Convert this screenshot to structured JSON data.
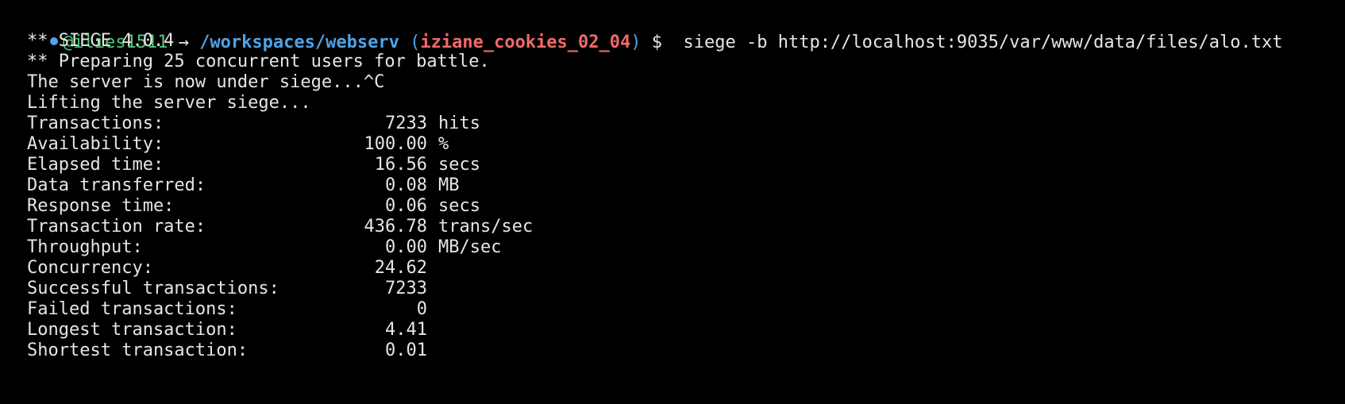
{
  "prompt": {
    "indicator_color": "#4fa3e8",
    "user": "@ilies1511",
    "arrow": "→",
    "path": "/workspaces/webserv",
    "paren_open": "(",
    "branch": "iziane_cookies_02_04",
    "paren_close": ")",
    "dollar": "$",
    "command": "siege -b http://localhost:9035/var/www/data/files/alo.txt"
  },
  "output": {
    "line1": "** SIEGE 4.0.4",
    "line2": "** Preparing 25 concurrent users for battle.",
    "line3": "The server is now under siege...^C",
    "line4": "Lifting the server siege..."
  },
  "stats": [
    {
      "label": "Transactions:",
      "value": "7233",
      "unit": "hits"
    },
    {
      "label": "Availability:",
      "value": "100.00",
      "unit": "%"
    },
    {
      "label": "Elapsed time:",
      "value": "16.56",
      "unit": "secs"
    },
    {
      "label": "Data transferred:",
      "value": "0.08",
      "unit": "MB"
    },
    {
      "label": "Response time:",
      "value": "0.06",
      "unit": "secs"
    },
    {
      "label": "Transaction rate:",
      "value": "436.78",
      "unit": "trans/sec"
    },
    {
      "label": "Throughput:",
      "value": "0.00",
      "unit": "MB/sec"
    },
    {
      "label": "Concurrency:",
      "value": "24.62",
      "unit": ""
    },
    {
      "label": "Successful transactions:",
      "value": "7233",
      "unit": ""
    },
    {
      "label": "Failed transactions:",
      "value": "0",
      "unit": ""
    },
    {
      "label": "Longest transaction:",
      "value": "4.41",
      "unit": ""
    },
    {
      "label": "Shortest transaction:",
      "value": "0.01",
      "unit": ""
    }
  ]
}
